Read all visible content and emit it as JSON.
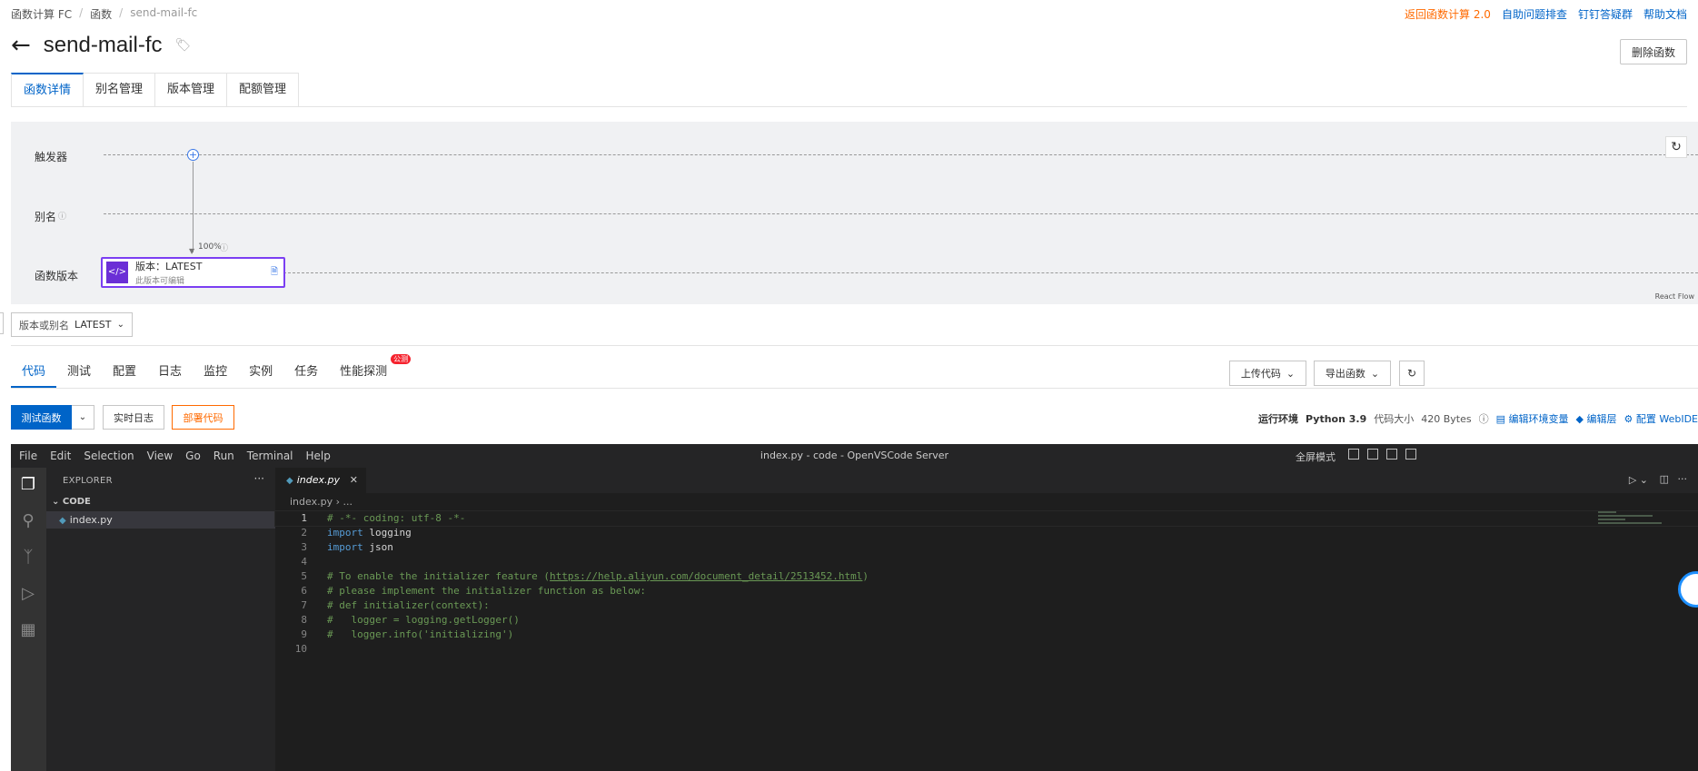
{
  "breadcrumb": [
    "函数计算 FC",
    "函数",
    "send-mail-fc"
  ],
  "top_links": {
    "back_fc2": "返回函数计算 2.0",
    "self_help": "自助问题排查",
    "dingtalk": "钉钉答疑群",
    "help_docs": "帮助文档"
  },
  "title": "send-mail-fc",
  "delete_label": "删除函数",
  "main_tabs": [
    "函数详情",
    "别名管理",
    "版本管理",
    "配额管理"
  ],
  "flow": {
    "lanes": [
      "触发器",
      "别名",
      "函数版本"
    ],
    "percent": "100%",
    "version_name": "版本：LATEST",
    "version_sub": "此版本可编辑",
    "react_flow": "React Flow"
  },
  "version_select": {
    "label": "版本或别名",
    "value": "LATEST"
  },
  "sub_tabs": [
    "代码",
    "测试",
    "配置",
    "日志",
    "监控",
    "实例",
    "任务",
    "性能探测"
  ],
  "sub_tab_badge": "公测",
  "upload_label": "上传代码",
  "export_label": "导出函数",
  "actions": {
    "test": "测试函数",
    "realtime_log": "实时日志",
    "deploy": "部署代码"
  },
  "runtime": {
    "runtime_label": "运行环境",
    "runtime_value": "Python 3.9",
    "size_label": "代码大小",
    "size_value": "420 Bytes",
    "edit_env": "编辑环境变量",
    "edit_layer": "编辑层",
    "config_webide": "配置 WebIDE"
  },
  "vscode": {
    "menu": [
      "File",
      "Edit",
      "Selection",
      "View",
      "Go",
      "Run",
      "Terminal",
      "Help"
    ],
    "window_title": "index.py - code - OpenVSCode Server",
    "fullscreen": "全屏模式",
    "explorer_title": "EXPLORER",
    "folder": "CODE",
    "file": "index.py",
    "tab": "index.py",
    "breadcrumb": "index.py › ...",
    "lines": [
      "# -*- coding: utf-8 -*-",
      "import logging",
      "import json",
      "",
      "# To enable the initializer feature (https://help.aliyun.com/document_detail/2513452.html)",
      "# please implement the initializer function as below:",
      "# def initializer(context):",
      "#   logger = logging.getLogger()",
      "#   logger.info('initializing')",
      ""
    ]
  },
  "colors": {
    "accent": "#0064c8",
    "orange": "#ff6a00",
    "version_border": "#7b3ff2"
  }
}
